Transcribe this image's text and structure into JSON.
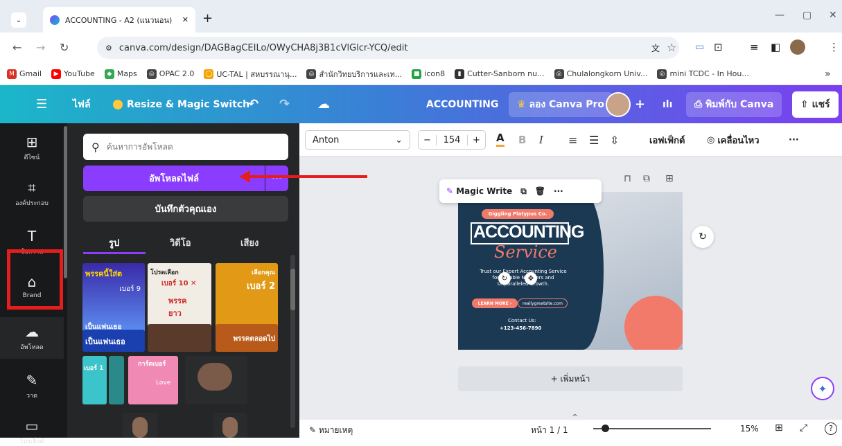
{
  "browser": {
    "tab_title": "ACCOUNTING - A2 (แนวนอน)",
    "url": "canva.com/design/DAGBagCEILo/OWyCHA8j3B1cVlGlcr-YCQ/edit",
    "bookmarks": [
      {
        "label": "Gmail",
        "color": "#d93025",
        "glyph": "M"
      },
      {
        "label": "YouTube",
        "color": "#ff0000",
        "glyph": "▶"
      },
      {
        "label": "Maps",
        "color": "#34a853",
        "glyph": "◆"
      },
      {
        "label": "OPAC 2.0",
        "color": "#444",
        "glyph": "◎"
      },
      {
        "label": "UC-TAL | สหบรรณานุ...",
        "color": "#f4a300",
        "glyph": "◯"
      },
      {
        "label": "สำนักวิทยบริการและเท...",
        "color": "#444",
        "glyph": "◎"
      },
      {
        "label": "icon8",
        "color": "#1fa345",
        "glyph": "■"
      },
      {
        "label": "Cutter-Sanborn nu...",
        "color": "#333",
        "glyph": "▮"
      },
      {
        "label": "Chulalongkorn Univ...",
        "color": "#444",
        "glyph": "◎"
      },
      {
        "label": "mini TCDC - In Hou...",
        "color": "#444",
        "glyph": "◎"
      }
    ],
    "bookmarks_more": "»"
  },
  "topbar": {
    "menu": "☰",
    "file": "ไฟล์",
    "resize": "Resize & Magic Switch",
    "undo": "↶",
    "redo": "↷",
    "cloud": "☁",
    "doc_title": "ACCOUNTING",
    "try_pro": "ลอง Canva Pro",
    "plus": "+",
    "analytics": "ılı",
    "print": "พิมพ์กับ Canva",
    "share": "แชร์"
  },
  "rail": [
    {
      "icon": "⊞",
      "label": "ดีไซน์"
    },
    {
      "icon": "⌗",
      "label": "องค์ประกอบ"
    },
    {
      "icon": "T",
      "label": "ข้อความ"
    },
    {
      "icon": "⌂",
      "label": "Brand"
    },
    {
      "icon": "☁",
      "label": "อัพโหลด"
    },
    {
      "icon": "✎",
      "label": "วาด"
    },
    {
      "icon": "▭",
      "label": "โปรเจ็กต์"
    }
  ],
  "panel": {
    "search_placeholder": "ค้นหาการอัพโหลด",
    "upload_btn": "อัพโหลดไฟล์",
    "more": "···",
    "record_btn": "บันทึกตัวคุณเอง",
    "tabs": [
      "รูป",
      "วิดีโอ",
      "เสียง"
    ],
    "thumbs": [
      {
        "line1": "พรรคนี้ใส่ต",
        "line2": "เบอร์ 9",
        "line3": "เป็นแฟนเธอ"
      },
      {
        "line1": "โปรดเลือก",
        "line2": "เบอร์ 10 ✕",
        "line3": "พรรคยาว"
      },
      {
        "line1": "เลือกคุณ",
        "line2": "เบอร์ 2",
        "line3": "พรรคตลอดไป"
      },
      {
        "line1": "เบอร์ 1",
        "line2": "",
        "line3": ""
      },
      {
        "line1": "การ์ดเบอร์",
        "line2": "Love",
        "line3": ""
      },
      {
        "line1": "",
        "line2": "",
        "line3": ""
      }
    ]
  },
  "format": {
    "font": "Anton",
    "minus": "−",
    "size": "154",
    "plus": "+",
    "color_a": "A",
    "bold": "B",
    "italic": "I",
    "effects": "เอฟเฟ็กต์",
    "animate": "เคลื่อนไหว",
    "more": "···"
  },
  "popup": {
    "magic_write": "Magic Write",
    "more": "···"
  },
  "design": {
    "company": "Giggling Platypus Co.",
    "title1": "ACCOUNTING",
    "title2": "Service",
    "body": "Trust our Expert Accounting Service for Reliable Numbers and Unparalleled Growth.",
    "learn": "LEARN MORE ›",
    "site": "reallygreatsite.com",
    "contact_label": "Contact Us:",
    "phone": "+123-456-7890"
  },
  "add_page": "+ เพิ่มหน้า",
  "bottom": {
    "notes": "หมายเหตุ",
    "page": "หน้า 1 / 1",
    "zoom": "15%",
    "caret": "^",
    "help": "?"
  }
}
